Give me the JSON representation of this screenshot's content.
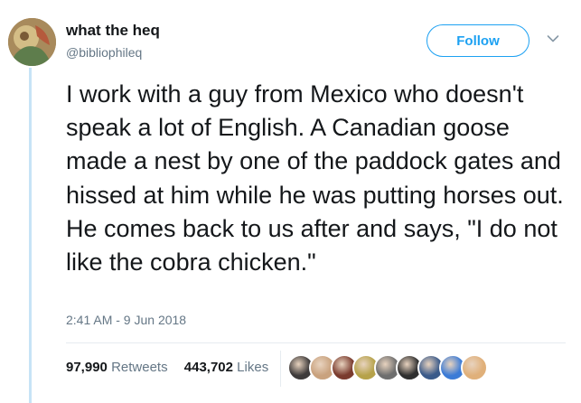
{
  "user": {
    "display_name": "what the heq",
    "handle": "@bibliophileq"
  },
  "follow_button": {
    "label": "Follow"
  },
  "tweet": {
    "text": "I work with a guy from Mexico who doesn't speak a lot of English. A Canadian goose made a nest by one of the paddock gates and hissed at him while he was putting horses out. He comes back to us after and says, \"I do not like the cobra chicken.\"",
    "timestamp": "2:41 AM - 9 Jun 2018"
  },
  "stats": {
    "retweets_count": "97,990",
    "retweets_label": "Retweets",
    "likes_count": "443,702",
    "likes_label": "Likes"
  },
  "colors": {
    "accent": "#1da1f2",
    "secondary_text": "#657786",
    "primary_text": "#14171a",
    "thread_line": "#c7e3f6"
  },
  "icons": {
    "menu": "chevron-down-icon"
  },
  "likers": [
    {
      "color": "#3d3a3a"
    },
    {
      "color": "#c9a27e"
    },
    {
      "color": "#7a3b2e"
    },
    {
      "color": "#b6a24a"
    },
    {
      "color": "#6e6e6e"
    },
    {
      "color": "#2f2f2f"
    },
    {
      "color": "#3a5a8a"
    },
    {
      "color": "#3b7bd6"
    },
    {
      "color": "#e0b07a"
    }
  ]
}
